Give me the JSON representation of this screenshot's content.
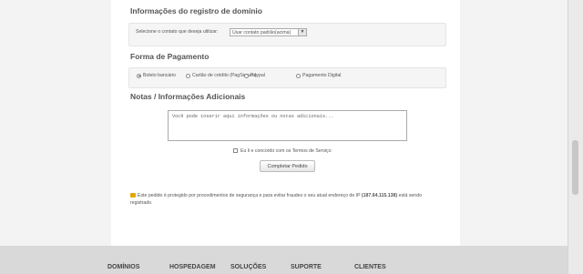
{
  "domain_section": {
    "title": "Informações do registro de domínio",
    "contact_label": "Selecione o contato que deseja utilizar:",
    "contact_select_value": "Usar contato padrão(acima)"
  },
  "payment_section": {
    "title": "Forma de Pagamento",
    "options": [
      "Boleto bancário",
      "Cartão de crédito (PagSeguro)",
      "Paypal",
      "Pagamento Digital"
    ],
    "selected_index": 0
  },
  "notes_section": {
    "title": "Notas / Informações Adicionais",
    "textarea_value": "Você pode inserir aqui informações ou notas adicionais..."
  },
  "terms": {
    "label": "Eu li e concordo com os Termos de Serviço"
  },
  "submit_button": {
    "label": "Completar Pedido"
  },
  "security_note": {
    "text_before": "Este pedido é protegido por procedimentos de segurança e para evitar fraudes o seu atual endereço de IP ",
    "ip": "(187.64.115.138)",
    "text_after": " está sendo registrado."
  },
  "footer_nav": [
    "DOMÍNIOS",
    "HOSPEDAGEM",
    "SOLUÇÕES",
    "SUPORTE",
    "CLIENTES"
  ],
  "icons": {
    "dropdown": "chevron-down-icon",
    "security": "lock-icon"
  }
}
